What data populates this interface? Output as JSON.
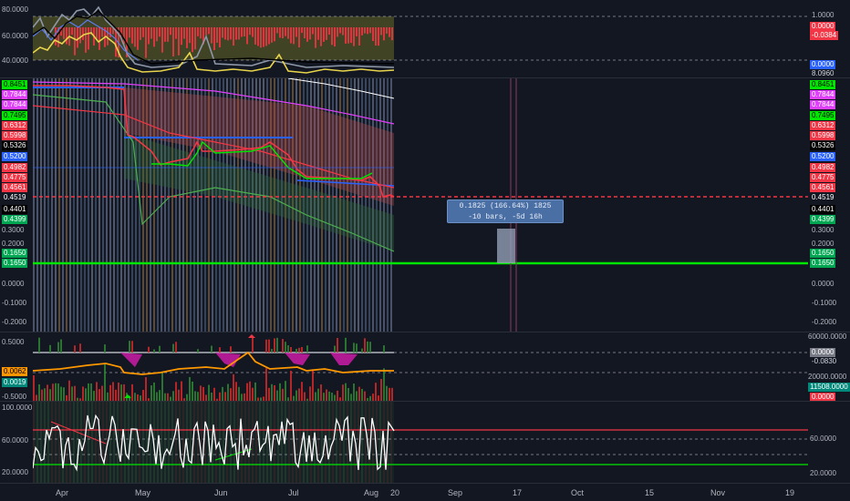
{
  "pane1": {
    "left_ticks": [
      "80.0000",
      "60.0000",
      "40.0000"
    ],
    "right_ticks": [
      "1.0000"
    ],
    "right_tags": [
      {
        "text": "0.0000",
        "bg": "#f23645",
        "fg": "#ffffff"
      },
      {
        "text": "-0.0384",
        "bg": "#f23645",
        "fg": "#ffffff"
      },
      {
        "text": "0.0000",
        "bg": "#2962ff",
        "fg": "#ffffff"
      },
      {
        "text": "8.0960",
        "bg": "#131722",
        "fg": "#d1d4dc"
      }
    ]
  },
  "pane2": {
    "left_tags": [
      {
        "text": "0.8451",
        "bg": "#00e600",
        "fg": "#000000"
      },
      {
        "text": "0.7844",
        "bg": "#e040fb",
        "fg": "#ffffff"
      },
      {
        "text": "0.7844",
        "bg": "#e040fb",
        "fg": "#ffffff"
      },
      {
        "text": "0.7495",
        "bg": "#00e600",
        "fg": "#000000"
      },
      {
        "text": "0.6312",
        "bg": "#f23645",
        "fg": "#ffffff"
      },
      {
        "text": "0.5998",
        "bg": "#f23645",
        "fg": "#ffffff"
      },
      {
        "text": "0.5326",
        "bg": "#000000",
        "fg": "#ffffff"
      },
      {
        "text": "0.5200",
        "bg": "#2962ff",
        "fg": "#ffffff"
      },
      {
        "text": "0.4982",
        "bg": "#f23645",
        "fg": "#ffffff"
      },
      {
        "text": "0.4775",
        "bg": "#f23645",
        "fg": "#ffffff"
      },
      {
        "text": "0.4561",
        "bg": "#f23645",
        "fg": "#ffffff"
      },
      {
        "text": "0.4519",
        "bg": "#131722",
        "fg": "#ffffff"
      },
      {
        "text": "0.4401",
        "bg": "#000000",
        "fg": "#ffffff"
      },
      {
        "text": "0.4399",
        "bg": "#00a651",
        "fg": "#ffffff"
      },
      {
        "text": "0.1650",
        "bg": "#00a651",
        "fg": "#ffffff"
      },
      {
        "text": "0.1650",
        "bg": "#00a651",
        "fg": "#ffffff"
      }
    ],
    "left_ticks": [
      "0.3000",
      "0.2000",
      "0.0000",
      "-0.1000",
      "-0.2000"
    ],
    "right_tags": [
      {
        "text": "0.8451",
        "bg": "#00e600",
        "fg": "#000000"
      },
      {
        "text": "0.7844",
        "bg": "#e040fb",
        "fg": "#ffffff"
      },
      {
        "text": "0.7844",
        "bg": "#e040fb",
        "fg": "#ffffff"
      },
      {
        "text": "0.7495",
        "bg": "#00e600",
        "fg": "#000000"
      },
      {
        "text": "0.6312",
        "bg": "#f23645",
        "fg": "#ffffff"
      },
      {
        "text": "0.5998",
        "bg": "#f23645",
        "fg": "#ffffff"
      },
      {
        "text": "0.5326",
        "bg": "#000000",
        "fg": "#ffffff"
      },
      {
        "text": "0.5200",
        "bg": "#2962ff",
        "fg": "#ffffff"
      },
      {
        "text": "0.4982",
        "bg": "#f23645",
        "fg": "#ffffff"
      },
      {
        "text": "0.4775",
        "bg": "#f23645",
        "fg": "#ffffff"
      },
      {
        "text": "0.4561",
        "bg": "#f23645",
        "fg": "#ffffff"
      },
      {
        "text": "0.4519",
        "bg": "#131722",
        "fg": "#ffffff"
      },
      {
        "text": "0.4401",
        "bg": "#000000",
        "fg": "#ffffff"
      },
      {
        "text": "0.4399",
        "bg": "#00a651",
        "fg": "#ffffff"
      },
      {
        "text": "0.1650",
        "bg": "#00a651",
        "fg": "#ffffff"
      },
      {
        "text": "0.1650",
        "bg": "#00a651",
        "fg": "#ffffff"
      }
    ],
    "right_ticks": [
      "0.3000",
      "0.2000",
      "0.0000",
      "-0.1000",
      "-0.2000"
    ]
  },
  "pane3": {
    "left_ticks": [
      "0.5000",
      "-0.5000"
    ],
    "left_tags": [
      {
        "text": "0.0062",
        "bg": "#ff9800",
        "fg": "#000000"
      },
      {
        "text": "0.0019",
        "bg": "#00897b",
        "fg": "#ffffff"
      }
    ],
    "right_ticks": [
      "60000.0000",
      "20000.0000"
    ],
    "right_tags": [
      {
        "text": "0.0000",
        "bg": "#787b86",
        "fg": "#ffffff"
      },
      {
        "text": "-0.0830",
        "bg": "#131722",
        "fg": "#d1d4dc"
      },
      {
        "text": "11508.0000",
        "bg": "#00897b",
        "fg": "#ffffff"
      },
      {
        "text": "0.0000",
        "bg": "#f23645",
        "fg": "#ffffff"
      }
    ]
  },
  "pane4": {
    "left_ticks": [
      "100.0000",
      "60.0000",
      "20.0000"
    ],
    "right_ticks": [
      "60.0000",
      "20.0000"
    ]
  },
  "measure": {
    "line1": "0.1825 (166.64%) 1825",
    "line2": "-10 bars, -5d 16h"
  },
  "x_axis": {
    "labels": [
      "Apr",
      "May",
      "Jun",
      "Jul",
      "Aug",
      "20",
      "Sep",
      "17",
      "Oct",
      "15",
      "Nov",
      "19"
    ]
  },
  "colors": {
    "background": "#131722",
    "price_line": "#f23645",
    "target_line": "#00e600",
    "measure_box": "#4a6fa5"
  }
}
